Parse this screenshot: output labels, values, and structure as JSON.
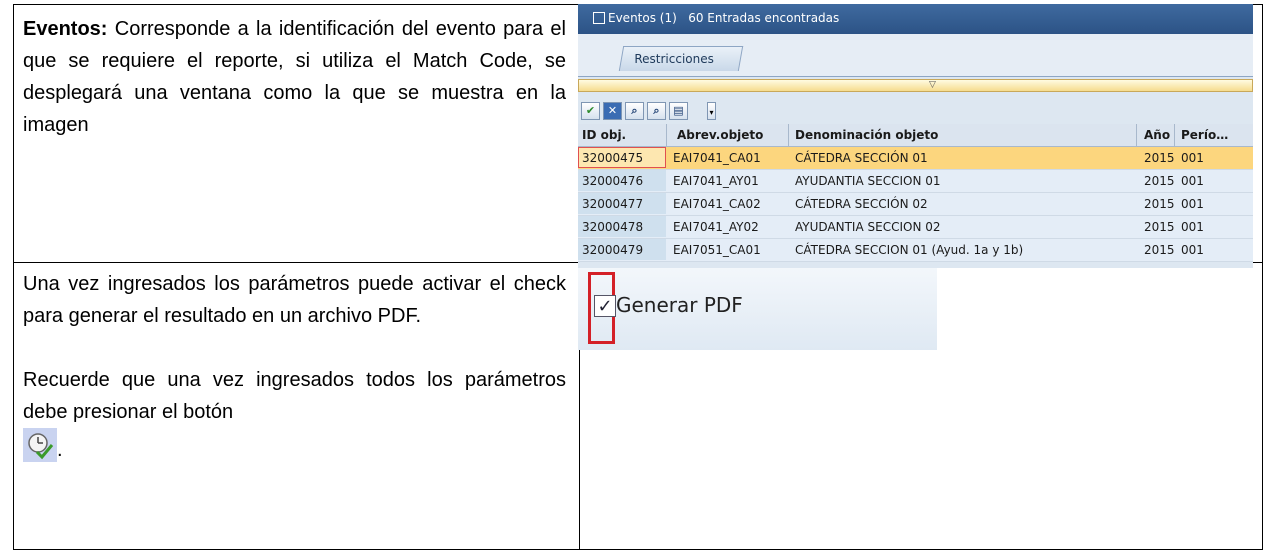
{
  "row1": {
    "bold_term": "Eventos:",
    "description": " Corresponde a la identificación del evento para el que se requiere el reporte, si utiliza el Match Code, se desplegará una ventana como la que se muestra en la imagen"
  },
  "row2": {
    "paragraph1": "Una vez ingresados los parámetros puede activar el check  para generar el resultado en un archivo PDF.",
    "paragraph2": "Recuerde que una vez ingresados todos los parámetros debe presionar el botón",
    "trailing_period": ".",
    "button_icon": "execute-clock-icon"
  },
  "sap_popup": {
    "title": "Eventos (1)   60 Entradas encontradas",
    "tab_label": "Restricciones",
    "toolbar_icons": [
      "check-icon",
      "cancel-icon",
      "find-icon",
      "find-next-icon",
      "print-icon"
    ],
    "columns": [
      "ID obj.",
      "Abrev.objeto",
      "Denominación objeto",
      "Año",
      "Perío…"
    ],
    "rows": [
      {
        "id": "32000475",
        "abrev": "EAI7041_CA01",
        "denom": "CÁTEDRA SECCIÓN 01",
        "anio": "2015",
        "periodo": "001",
        "selected": true
      },
      {
        "id": "32000476",
        "abrev": "EAI7041_AY01",
        "denom": "AYUDANTIA SECCION 01",
        "anio": "2015",
        "periodo": "001",
        "selected": false
      },
      {
        "id": "32000477",
        "abrev": "EAI7041_CA02",
        "denom": "CÁTEDRA SECCIÓN 02",
        "anio": "2015",
        "periodo": "001",
        "selected": false
      },
      {
        "id": "32000478",
        "abrev": "EAI7041_AY02",
        "denom": "AYUDANTIA SECCION 02",
        "anio": "2015",
        "periodo": "001",
        "selected": false
      },
      {
        "id": "32000479",
        "abrev": "EAI7051_CA01",
        "denom": "CÁTEDRA SECCION 01 (Ayud. 1a y 1b)",
        "anio": "2015",
        "periodo": "001",
        "selected": false
      }
    ]
  },
  "pdf_option": {
    "label": "Generar PDF",
    "checked": true
  },
  "colors": {
    "sap_title_bar": "#2c5386",
    "selected_row": "#fcd67e",
    "highlight_border": "#d42027"
  }
}
